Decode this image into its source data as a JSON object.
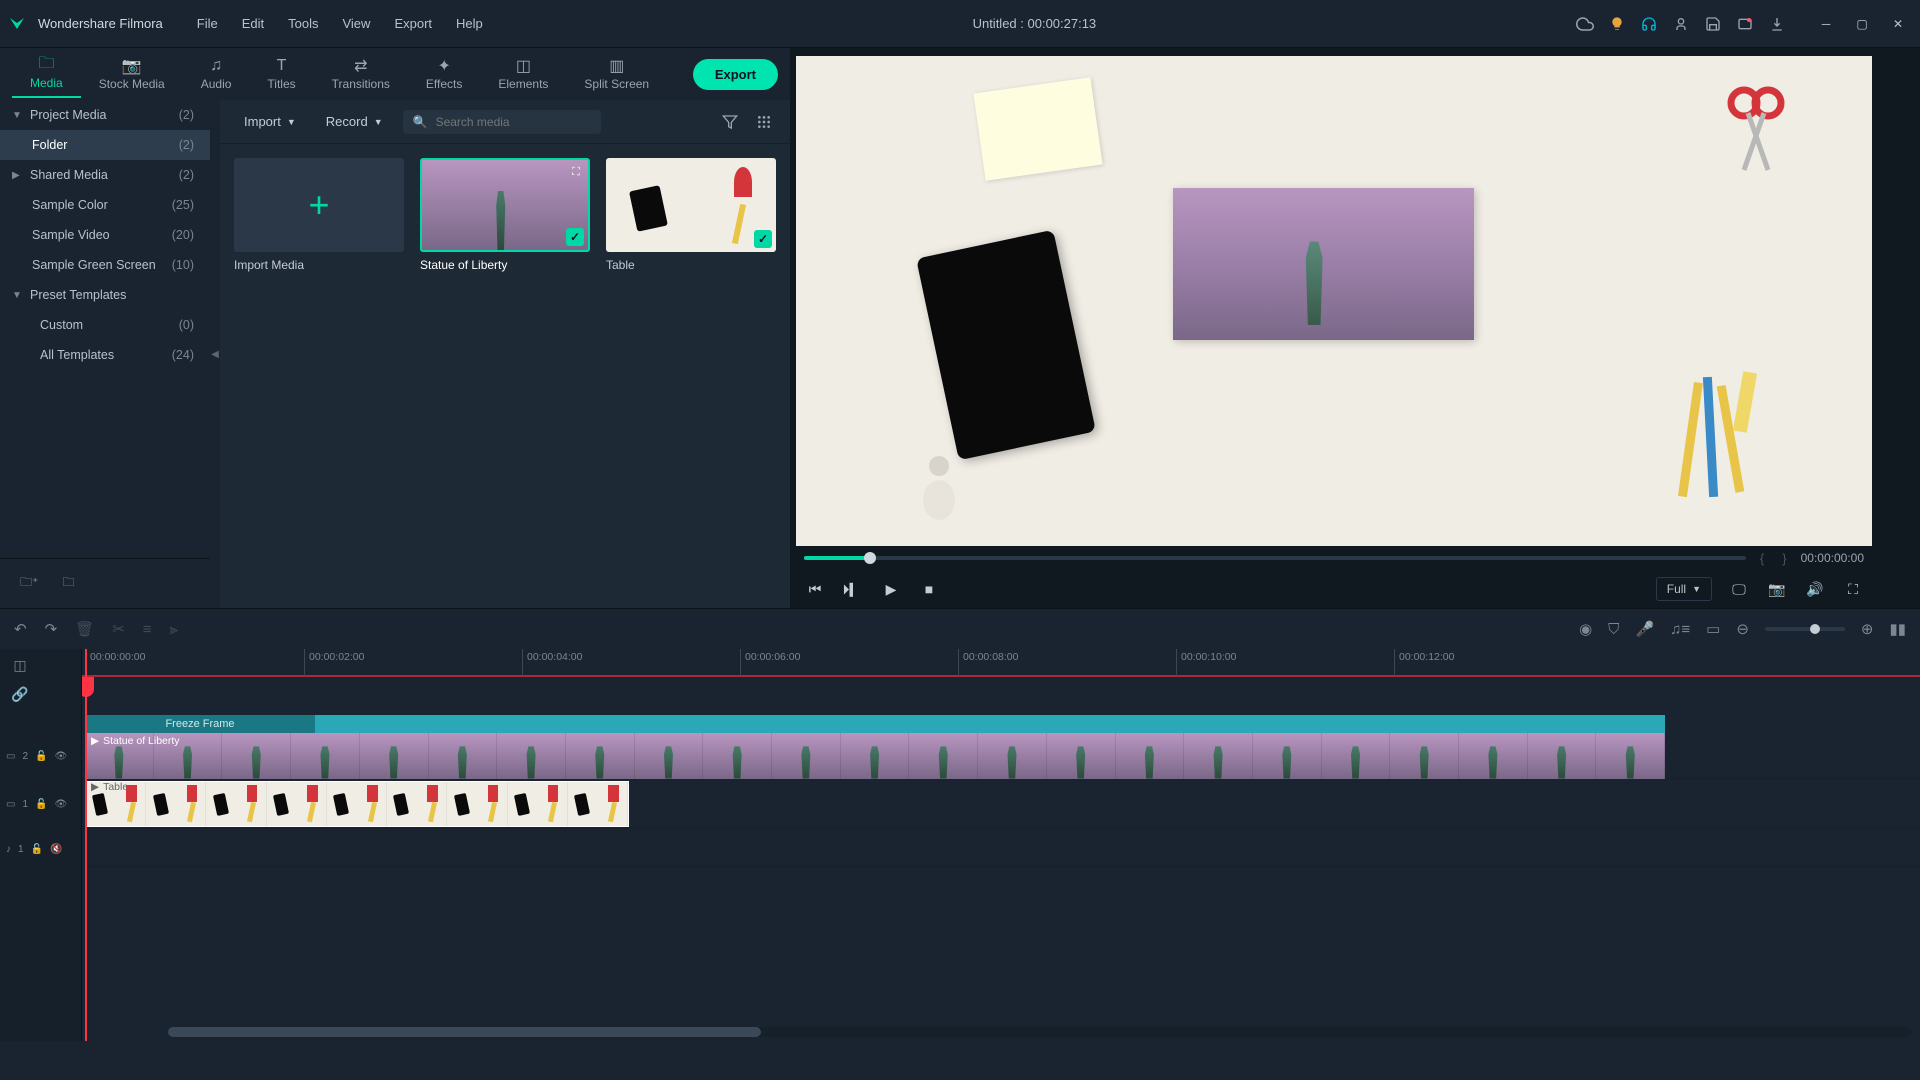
{
  "app": {
    "name": "Wondershare Filmora"
  },
  "menu": [
    "File",
    "Edit",
    "Tools",
    "View",
    "Export",
    "Help"
  ],
  "project_title": "Untitled : 00:00:27:13",
  "tabs": [
    {
      "label": "Media",
      "active": true
    },
    {
      "label": "Stock Media"
    },
    {
      "label": "Audio"
    },
    {
      "label": "Titles"
    },
    {
      "label": "Transitions"
    },
    {
      "label": "Effects"
    },
    {
      "label": "Elements"
    },
    {
      "label": "Split Screen"
    }
  ],
  "export_label": "Export",
  "sidebar": {
    "items": [
      {
        "label": "Project Media",
        "count": "(2)",
        "arrow": "▼",
        "indent": 0
      },
      {
        "label": "Folder",
        "count": "(2)",
        "indent": 1,
        "selected": true
      },
      {
        "label": "Shared Media",
        "count": "(2)",
        "arrow": "▶",
        "indent": 0
      },
      {
        "label": "Sample Color",
        "count": "(25)",
        "indent": 1
      },
      {
        "label": "Sample Video",
        "count": "(20)",
        "indent": 1
      },
      {
        "label": "Sample Green Screen",
        "count": "(10)",
        "indent": 1
      },
      {
        "label": "Preset Templates",
        "count": "",
        "arrow": "▼",
        "indent": 0
      },
      {
        "label": "Custom",
        "count": "(0)",
        "indent": 2
      },
      {
        "label": "All Templates",
        "count": "(24)",
        "indent": 2
      }
    ]
  },
  "media_toolbar": {
    "import": "Import",
    "record": "Record",
    "search_placeholder": "Search media"
  },
  "media_items": [
    {
      "label": "Import Media",
      "type": "import"
    },
    {
      "label": "Statue of Liberty",
      "selected": true,
      "check": true
    },
    {
      "label": "Table",
      "check": true
    }
  ],
  "preview": {
    "time": "00:00:00:00",
    "quality": "Full"
  },
  "timeline": {
    "ruler": [
      "00:00:00:00",
      "00:00:02:00",
      "00:00:04:00",
      "00:00:06:00",
      "00:00:08:00",
      "00:00:10:00",
      "00:00:12:00"
    ],
    "freeze_label": "Freeze Frame",
    "tracks": [
      {
        "id": "2",
        "type": "video",
        "clip": "Statue of Liberty"
      },
      {
        "id": "1",
        "type": "video",
        "clip": "Table"
      },
      {
        "id": "1",
        "type": "audio"
      }
    ]
  }
}
